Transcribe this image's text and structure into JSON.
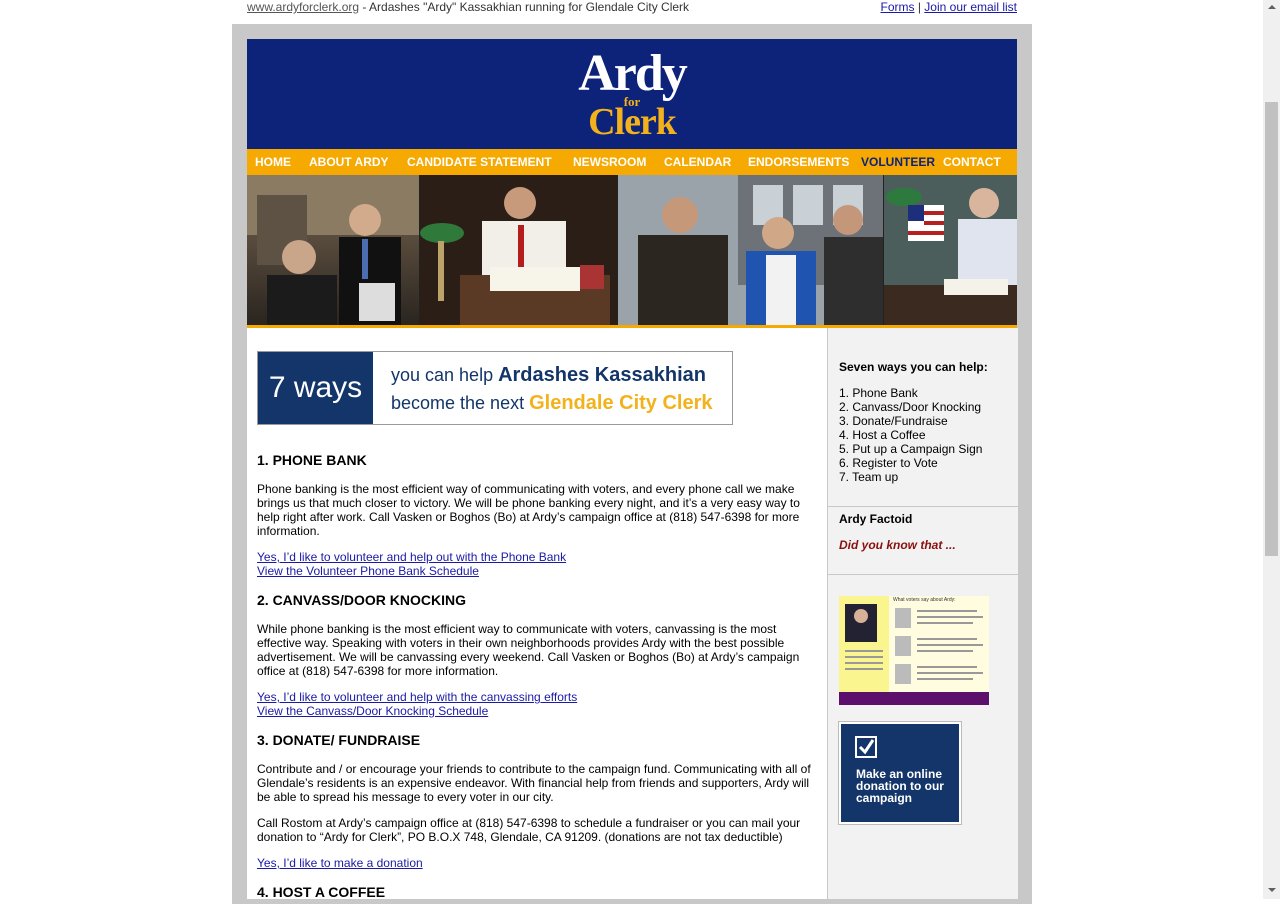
{
  "topbar": {
    "site_link": "www.ardyforclerk.org",
    "tagline": " - Ardashes \"Ardy\" Kassakhian running for Glendale City Clerk",
    "forms_link": "Forms",
    "separator": " | ",
    "email_link": "Join our email list"
  },
  "logo": {
    "ardy": "Ardy",
    "for": "for",
    "clerk": "Clerk"
  },
  "nav": {
    "items": [
      "HOME",
      "ABOUT ARDY",
      "CANDIDATE STATEMENT",
      "NEWSROOM",
      "CALENDAR",
      "ENDORSEMENTS",
      "VOLUNTEER",
      "CONTACT"
    ],
    "active": "VOLUNTEER"
  },
  "banner": {
    "ways": "7 ways",
    "line1_pre": "you can help ",
    "line1_bold": "Ardashes Kassakhian",
    "line2_pre": "become the next ",
    "line2_bold": "Glendale City Clerk"
  },
  "sections": [
    {
      "heading": "1. PHONE BANK",
      "paragraphs": [
        "Phone banking is the most efficient way of communicating with voters, and every phone call we make brings us that much closer to victory. We will be phone banking every night, and it’s a very easy way to help right after work. Call Vasken or Boghos (Bo) at Ardy’s campaign office at (818) 547-6398 for more information."
      ],
      "links": [
        "Yes, I’d like to volunteer and help out with the Phone Bank",
        "View the Volunteer Phone Bank Schedule"
      ]
    },
    {
      "heading": "2. CANVASS/DOOR KNOCKING",
      "paragraphs": [
        "While phone banking is the most efficient way to communicate with voters, canvassing is the most effective way. Speaking with voters in their own neighborhoods provides Ardy with the best possible advertisement. We will be canvassing every weekend. Call Vasken or Boghos (Bo) at Ardy’s campaign office at (818) 547-6398 for more information."
      ],
      "links": [
        "Yes, I’d like to volunteer and help with the canvassing efforts ",
        "View the Canvass/Door Knocking Schedule"
      ]
    },
    {
      "heading": "3. DONATE/ FUNDRAISE",
      "paragraphs": [
        "Contribute and / or encourage your friends to contribute to the campaign fund. Communicating with all of Glendale’s residents is an expensive endeavor. With financial help from friends and supporters, Ardy will be able to spread his message to every voter in our city.",
        "Call Rostom at Ardy’s campaign office at (818) 547-6398 to schedule a fundraiser or you can mail your donation to “Ardy for Clerk”, PO B.O.X 748, Glendale, CA 91209. (donations are not tax deductible)"
      ],
      "links": [
        "Yes, I’d like to make a donation"
      ]
    },
    {
      "heading": "4. HOST A COFFEE",
      "paragraphs": [],
      "links": []
    }
  ],
  "sidebar": {
    "heading": "Seven ways you can help:",
    "items": [
      "1. Phone Bank",
      "2. Canvass/Door Knocking",
      "3. Donate/Fundraise",
      "4. Host a Coffee",
      "5. Put up a Campaign Sign",
      "6. Register to Vote",
      "7. Team up"
    ],
    "factoid_heading": "Ardy Factoid",
    "factoid_text": "Did you know that ...",
    "voters_title": "What voters say about Ardy:",
    "donate_text": "Make an online donation to our campaign"
  },
  "colors": {
    "header_blue": "#0d2279",
    "nav_orange": "#f6a900",
    "gold": "#f3b21b",
    "link": "#1a1aa6"
  }
}
